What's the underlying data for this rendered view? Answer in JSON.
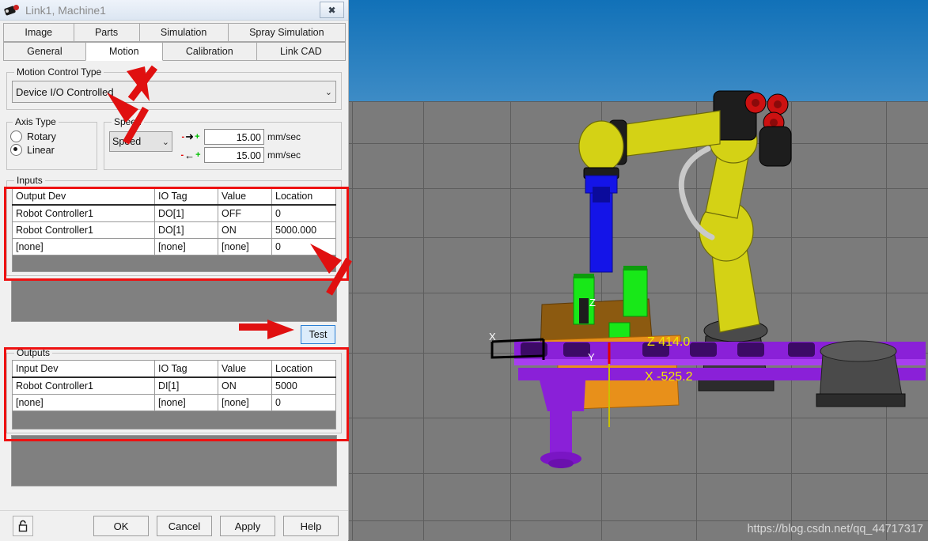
{
  "window": {
    "title": "Link1, Machine1",
    "icon": "link-icon",
    "close_label": "✖"
  },
  "tabs": {
    "row1": [
      {
        "label": "Image",
        "active": false
      },
      {
        "label": "Parts",
        "active": false
      },
      {
        "label": "Simulation",
        "active": false
      },
      {
        "label": "Spray Simulation",
        "active": false
      }
    ],
    "row2": [
      {
        "label": "General",
        "active": false
      },
      {
        "label": "Motion",
        "active": true
      },
      {
        "label": "Calibration",
        "active": false
      },
      {
        "label": "Link CAD",
        "active": false
      }
    ]
  },
  "motion_control": {
    "legend": "Motion Control Type",
    "selected": "Device I/O Controlled",
    "caret": "⌄"
  },
  "axis_type": {
    "legend": "Axis Type",
    "options": [
      {
        "label": "Rotary",
        "selected": false
      },
      {
        "label": "Linear",
        "selected": true
      }
    ]
  },
  "speed": {
    "legend": "Speed",
    "mode": "Speed",
    "caret": "⌄",
    "forward": {
      "icon": "arrow-right-icon",
      "minus": "-",
      "arrow": "➜",
      "plus": "+",
      "value": "15.00",
      "unit": "mm/sec"
    },
    "reverse": {
      "icon": "arrow-left-icon",
      "minus": "-",
      "arrow": "←",
      "plus": "+",
      "value": "15.00",
      "unit": "mm/sec"
    }
  },
  "inputs": {
    "legend": "Inputs",
    "columns": [
      "Output Dev",
      "IO Tag",
      "Value",
      "Location"
    ],
    "rows": [
      [
        "Robot Controller1",
        "DO[1]",
        "OFF",
        "0"
      ],
      [
        "Robot Controller1",
        "DO[1]",
        "ON",
        "5000.000"
      ],
      [
        "[none]",
        "[none]",
        "[none]",
        "0"
      ]
    ]
  },
  "test_button": {
    "label": "Test"
  },
  "outputs": {
    "legend": "Outputs",
    "columns": [
      "Input Dev",
      "IO Tag",
      "Value",
      "Location"
    ],
    "rows": [
      [
        "Robot Controller1",
        "DI[1]",
        "ON",
        "5000"
      ],
      [
        "[none]",
        "[none]",
        "[none]",
        "0"
      ]
    ]
  },
  "footer": {
    "lock_icon": "unlocked-padlock-icon",
    "buttons": [
      {
        "label": "OK"
      },
      {
        "label": "Cancel"
      },
      {
        "label": "Apply"
      },
      {
        "label": "Help"
      }
    ]
  },
  "viewport": {
    "labels": {
      "z_axis": "Z",
      "x_axis": "X",
      "y_axis": "Y",
      "z_value": "Z 414.0",
      "x_value": "X -525.2"
    },
    "watermark": "https://blog.csdn.net/qq_44717317",
    "colors": {
      "sky_top": "#1171b8",
      "sky_bottom": "#3e8cc6",
      "floor": "#7b7b7b",
      "robot_yellow": "#d4d215",
      "robot_black": "#1d1d1d",
      "robot_red": "#cc1111",
      "rail_purple": "#8a20d8",
      "table_orange": "#e08a12",
      "table_brown": "#8c5a10",
      "part_green": "#18e818",
      "tool_blue": "#1414e8",
      "axis_label_yellow": "#f2e800"
    }
  },
  "annotations": {
    "box_inputs": "red-highlight-box-inputs",
    "box_outputs": "red-highlight-box-outputs",
    "arrow_motion_tab": "red-arrow-pointing-to-motion-tab",
    "arrow_control_type": "red-arrow-pointing-to-control-type",
    "arrow_location_value": "red-arrow-pointing-to-location-value",
    "arrow_test": "red-arrow-pointing-to-test-button"
  }
}
